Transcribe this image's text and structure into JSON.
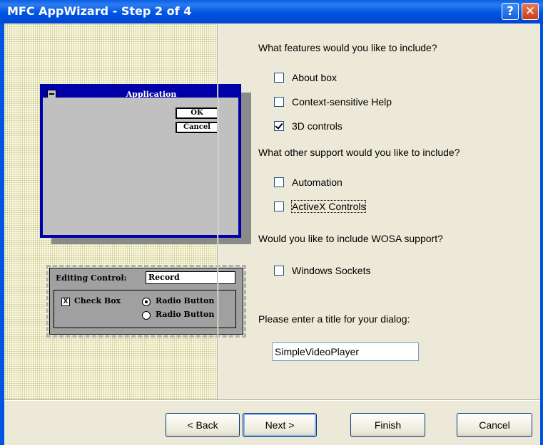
{
  "window": {
    "title": "MFC AppWizard - Step 2 of 4",
    "help_glyph": "?",
    "close_glyph": "✕"
  },
  "preview": {
    "app_title": "Application",
    "ok_label": "OK",
    "cancel_label": "Cancel",
    "editing_label": "Editing Control:",
    "editing_value": "Record",
    "checkbox_label": "Check Box",
    "checkbox_mark": "X",
    "radio1_label": "Radio Button",
    "radio2_label": "Radio Button"
  },
  "options": {
    "features_question": "What features would you like to include?",
    "about_box": {
      "label": "About box",
      "checked": false
    },
    "context_help": {
      "label": "Context-sensitive Help",
      "checked": false
    },
    "controls_3d": {
      "label": "3D controls",
      "checked": true
    },
    "support_question": "What other support would you like to include?",
    "automation": {
      "label": "Automation",
      "checked": false
    },
    "activex": {
      "label": "ActiveX Controls",
      "checked": false
    },
    "wosa_question": "Would you like to include WOSA support?",
    "windows_sockets": {
      "label": "Windows Sockets",
      "checked": false
    },
    "title_prompt": "Please enter a title for your dialog:",
    "title_value": "SimpleVideoPlayer"
  },
  "buttons": {
    "back": "< Back",
    "next": "Next >",
    "finish": "Finish",
    "cancel": "Cancel"
  },
  "colors": {
    "title_bar": "#0054e3",
    "dialog_bg": "#ece9d8",
    "preview_bg": "#fbfbe6"
  }
}
